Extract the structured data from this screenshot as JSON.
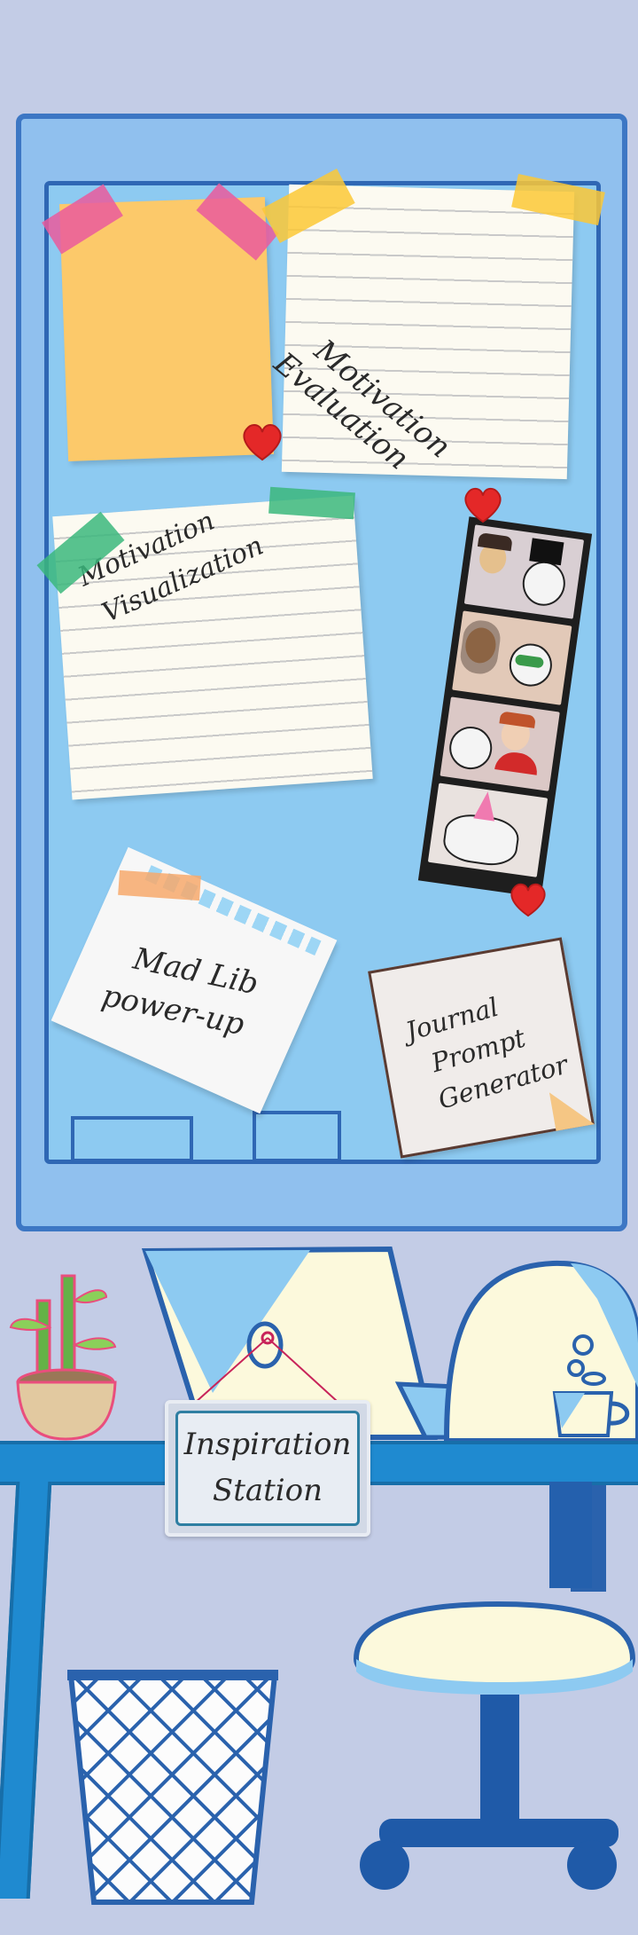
{
  "cards": {
    "evaluation": {
      "line1": "Motivation",
      "line2": "Evaluation"
    },
    "visualization": {
      "line1": "Motivation",
      "line2": "Visualization"
    },
    "madlib": {
      "line1": "Mad Lib",
      "line2": "power-up"
    },
    "journal": {
      "line1": "Journal",
      "line2": "Prompt",
      "line3": "Generator"
    }
  },
  "sign": {
    "line1": "Inspiration",
    "line2": "Station"
  },
  "colors": {
    "background": "#c3cce6",
    "board": "#8dcaf1",
    "frame": "#3d77c4",
    "desk": "#1f8ad0",
    "sticky_yellow": "#fcc96a",
    "tape_pink": "#ea5a9c",
    "tape_yellow": "#fbc836",
    "tape_green": "#3bb77d",
    "tape_orange": "#f7a96c",
    "heart": "#e42828"
  },
  "icons": [
    "heart-icon",
    "photo-strip",
    "plant-icon",
    "mug-icon",
    "chair-icon",
    "wastebasket-icon",
    "laptop-icon"
  ]
}
